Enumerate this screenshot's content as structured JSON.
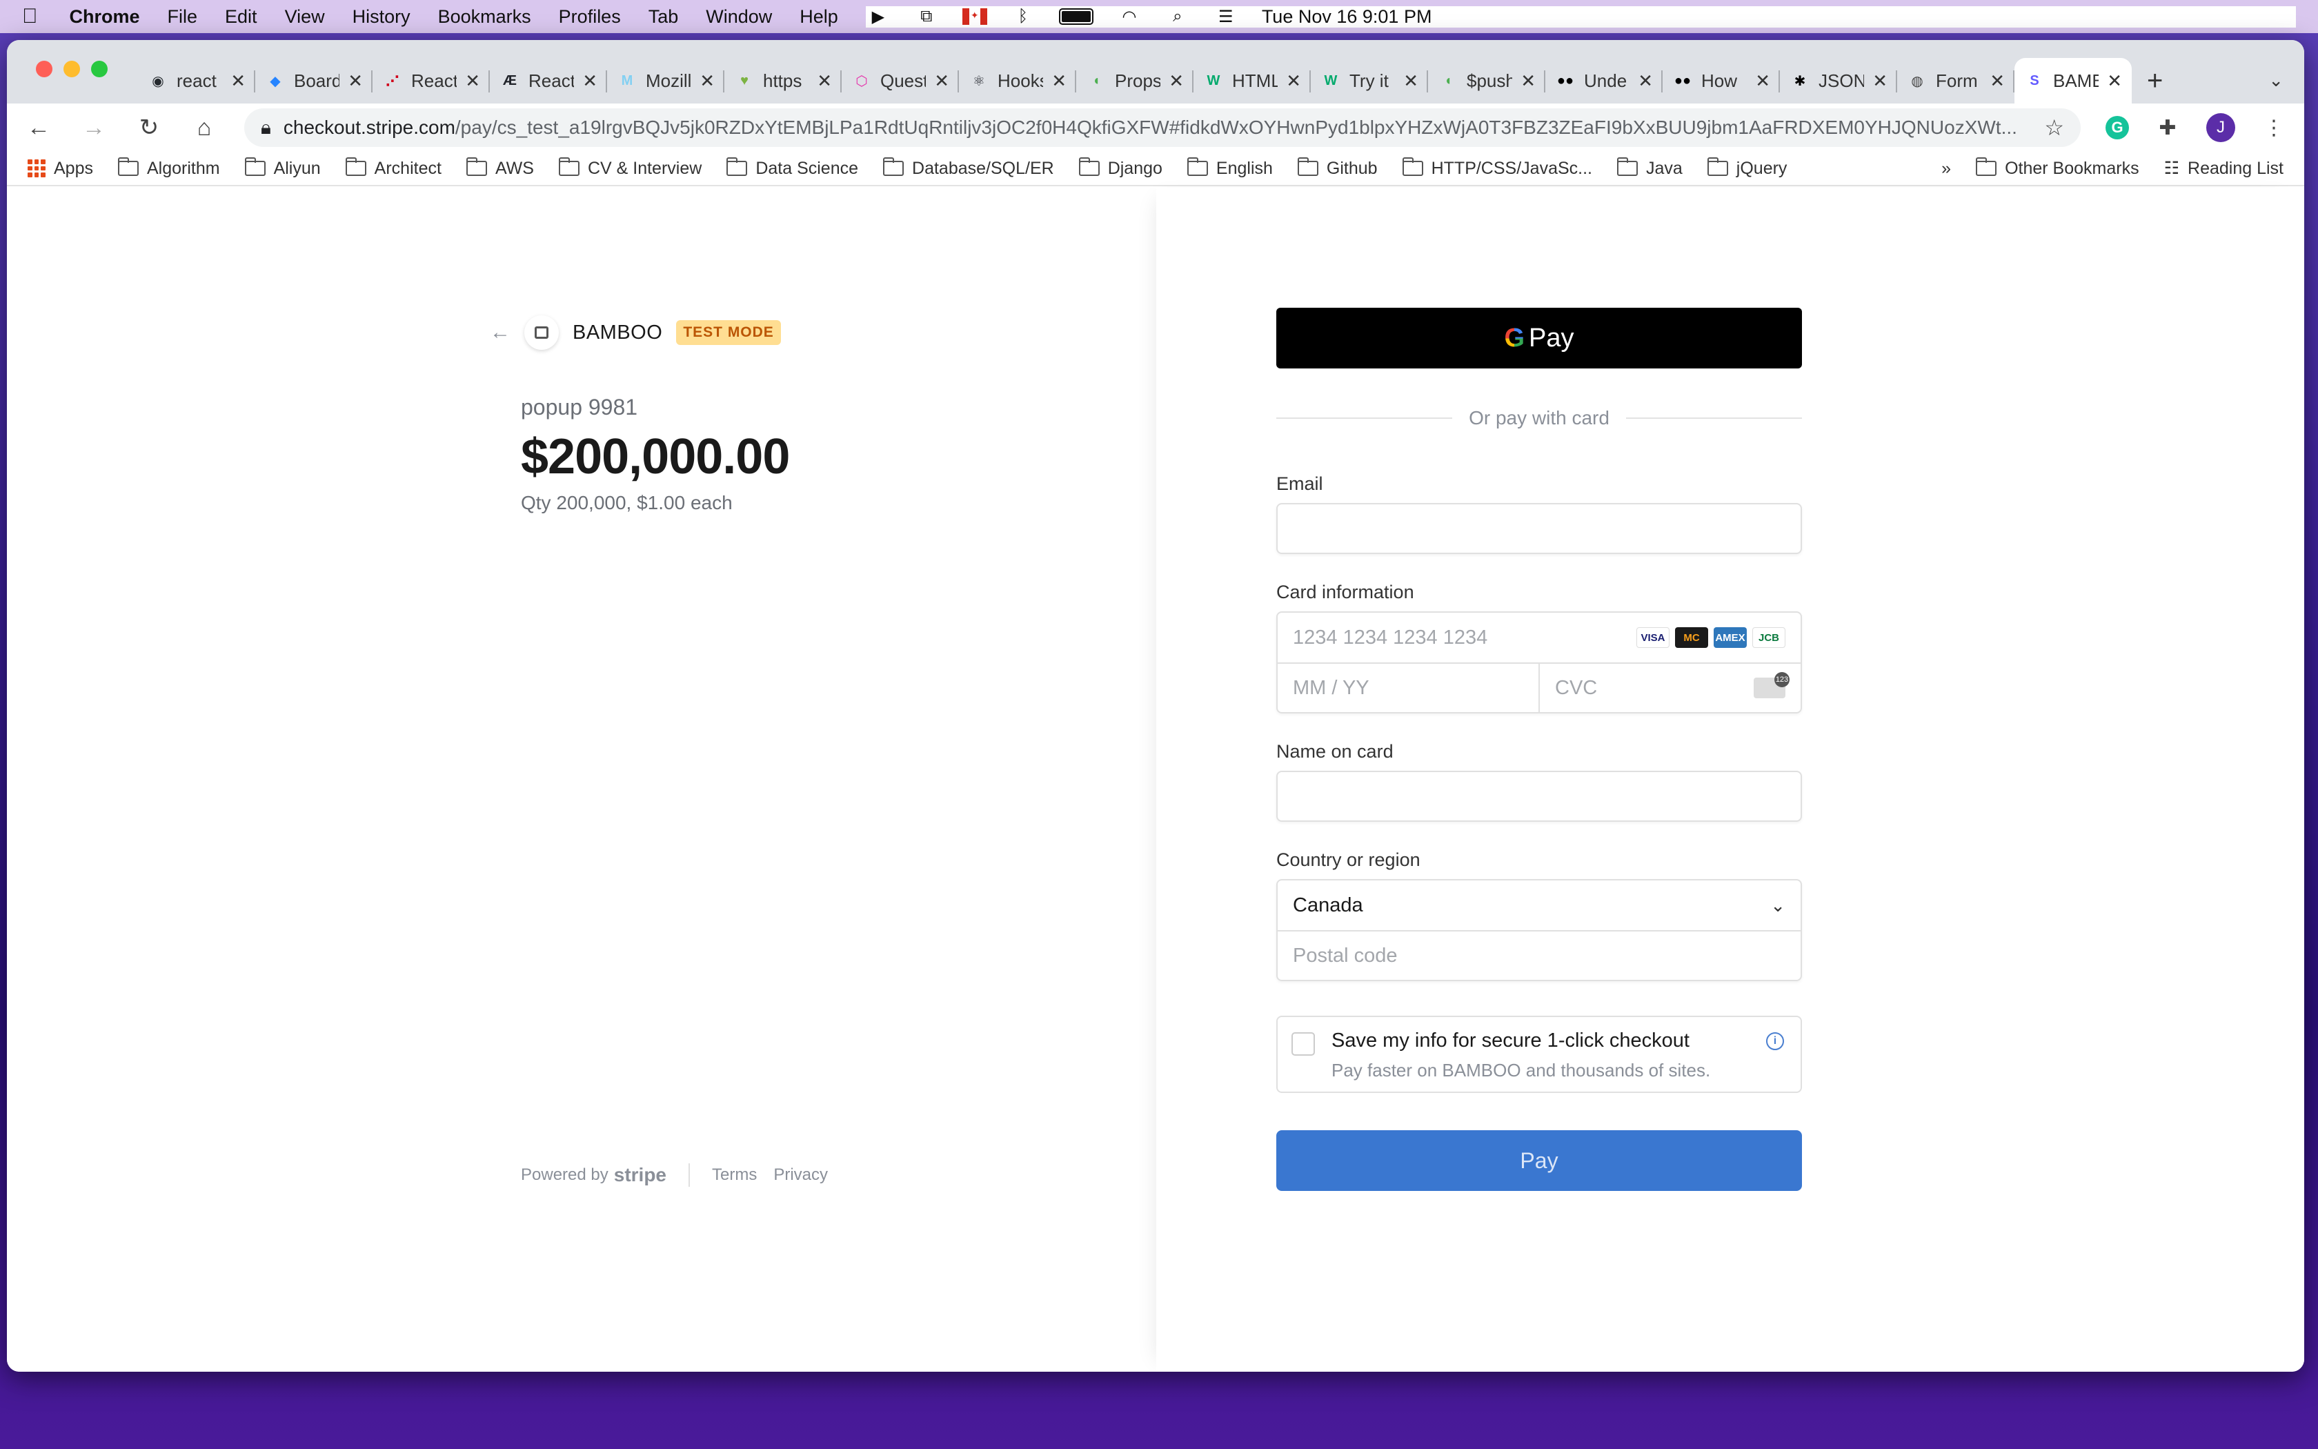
{
  "menubar": {
    "apple": "",
    "app": "Chrome",
    "items": [
      "File",
      "Edit",
      "View",
      "History",
      "Bookmarks",
      "Profiles",
      "Tab",
      "Window",
      "Help"
    ],
    "datetime": "Tue Nov 16  9:01 PM"
  },
  "tabs": [
    {
      "title": "react",
      "icon": "github-icon",
      "color": "#24292e",
      "glyph": "◉"
    },
    {
      "title": "Board",
      "icon": "jira-icon",
      "color": "#2684ff",
      "glyph": "◆"
    },
    {
      "title": "React",
      "icon": "flow-icon",
      "color": "#d0021b",
      "glyph": "⋰"
    },
    {
      "title": "React",
      "icon": "react-icon",
      "color": "#20232a",
      "glyph": "Æ"
    },
    {
      "title": "Mozilla",
      "icon": "mdn-icon",
      "color": "#83d0f2",
      "glyph": "M"
    },
    {
      "title": "https",
      "icon": "heart-icon",
      "color": "#7cb342",
      "glyph": "♥"
    },
    {
      "title": "Questions",
      "icon": "graphql-icon",
      "color": "#e535ab",
      "glyph": "⬡"
    },
    {
      "title": "Hooks",
      "icon": "react-icon",
      "color": "#20232a",
      "glyph": "⚛"
    },
    {
      "title": "Props",
      "icon": "leaf-icon",
      "color": "#4caf50",
      "glyph": "◖"
    },
    {
      "title": "HTML",
      "icon": "w3-icon",
      "color": "#04aa6d",
      "glyph": "W"
    },
    {
      "title": "Try it",
      "icon": "w3-icon",
      "color": "#04aa6d",
      "glyph": "W"
    },
    {
      "title": "$push",
      "icon": "mongodb-icon",
      "color": "#4caf50",
      "glyph": "◖"
    },
    {
      "title": "Unde",
      "icon": "medium-icon",
      "color": "#000000",
      "glyph": "●●"
    },
    {
      "title": "How",
      "icon": "medium-icon",
      "color": "#000000",
      "glyph": "●●"
    },
    {
      "title": "JSON",
      "icon": "json-icon",
      "color": "#000000",
      "glyph": "✱"
    },
    {
      "title": "Form",
      "icon": "globe-icon",
      "color": "#444444",
      "glyph": "◍"
    },
    {
      "title": "BAMBOO",
      "icon": "stripe-icon",
      "color": "#635bff",
      "glyph": "S",
      "active": true
    }
  ],
  "toolbar": {
    "url_host": "checkout.stripe.com",
    "url_path": "/pay/cs_test_a19lrgvBQJv5jk0RZDxYtEMBjLPa1RdtUqRntiljv3jOC2f0H4QkfiGXFW#fidkdWxOYHwnPyd1blpxYHZxWjA0T3FBZ3ZEaFI9bXxBUU9jbm1AaFRDXEM0YHJQNUozXWt...",
    "avatar_letter": "J"
  },
  "bookmarks": {
    "apps": "Apps",
    "folders": [
      "Algorithm",
      "Aliyun",
      "Architect",
      "AWS",
      "CV & Interview",
      "Data Science",
      "Database/SQL/ER",
      "Django",
      "English",
      "Github",
      "HTTP/CSS/JavaSc...",
      "Java",
      "jQuery"
    ],
    "more": "»",
    "other": "Other Bookmarks",
    "reading_list": "Reading List"
  },
  "summary": {
    "merchant": "BAMBOO",
    "test_badge": "TEST MODE",
    "product": "popup 9981",
    "amount": "$200,000.00",
    "qty": "Qty 200,000, $1.00 each"
  },
  "footer": {
    "powered_by": "Powered by",
    "stripe": "stripe",
    "terms": "Terms",
    "privacy": "Privacy"
  },
  "form": {
    "gpay_label": "Pay",
    "gpay_g": "G",
    "divider": "Or pay with card",
    "email_label": "Email",
    "email_value": "",
    "card_label": "Card information",
    "card_number_placeholder": "1234 1234 1234 1234",
    "expiry_placeholder": "MM / YY",
    "cvc_placeholder": "CVC",
    "brands": [
      {
        "name": "VISA",
        "bg": "#ffffff",
        "fg": "#1a1f71"
      },
      {
        "name": "MC",
        "bg": "#1a1a1a",
        "fg": "#f79e1b"
      },
      {
        "name": "AMEX",
        "bg": "#2e77bb",
        "fg": "#ffffff"
      },
      {
        "name": "JCB",
        "bg": "#ffffff",
        "fg": "#0b7a3e"
      }
    ],
    "name_label": "Name on card",
    "name_value": "",
    "country_label": "Country or region",
    "country_value": "Canada",
    "postal_placeholder": "Postal code",
    "save_title": "Save my info for secure 1-click checkout",
    "save_sub": "Pay faster on BAMBOO and thousands of sites.",
    "pay_button": "Pay"
  },
  "colors": {
    "pay_button": "#3a77d0",
    "test_badge_bg": "#ffde92",
    "test_badge_fg": "#bb5504"
  }
}
